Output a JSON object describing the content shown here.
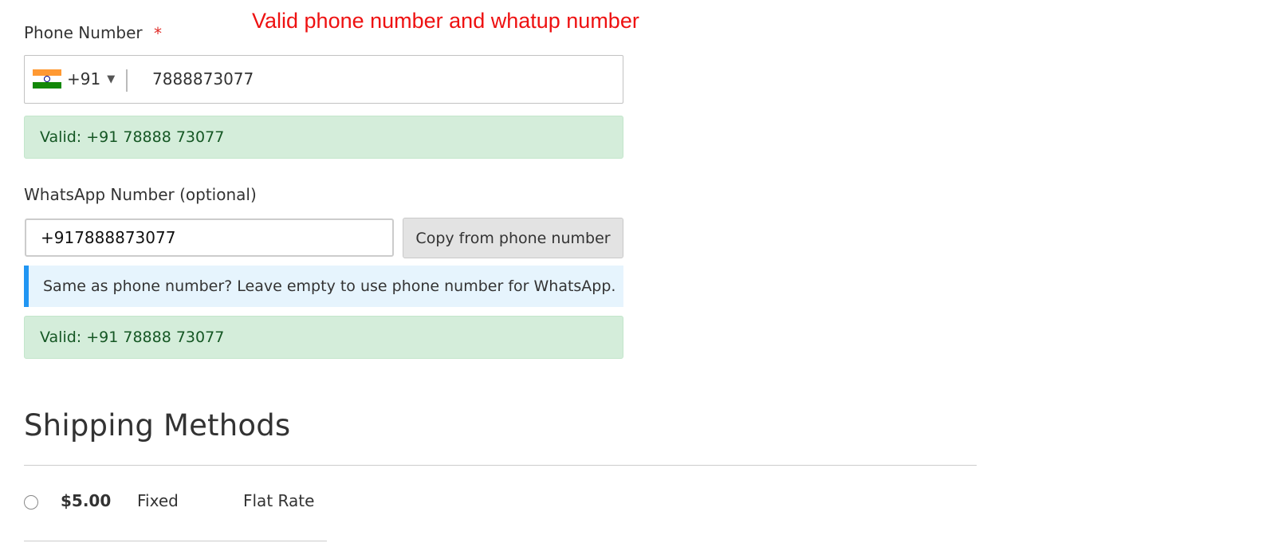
{
  "annotation": {
    "text": "Valid phone number and whatup number",
    "color": "#ee1111"
  },
  "phone": {
    "label": "Phone Number",
    "required_mark": "*",
    "country": {
      "flag_icon": "india-flag-icon",
      "dial_code": "+91",
      "caret": "▼"
    },
    "value": "7888873077",
    "validation": "Valid: +91 78888 73077"
  },
  "whatsapp": {
    "label": "WhatsApp Number (optional)",
    "value": "+917888873077",
    "copy_button": "Copy from phone number",
    "note": "Same as phone number? Leave empty to use phone number for WhatsApp.",
    "validation": "Valid: +91 78888 73077"
  },
  "shipping": {
    "title": "Shipping Methods",
    "methods": [
      {
        "price": "$5.00",
        "method": "Fixed",
        "carrier": "Flat Rate",
        "selected": false
      }
    ]
  },
  "colors": {
    "success_bg": "#d4edda",
    "success_text": "#155724",
    "info_bg": "#e6f4fd",
    "info_border": "#2196f3",
    "required": "#e02b27"
  }
}
